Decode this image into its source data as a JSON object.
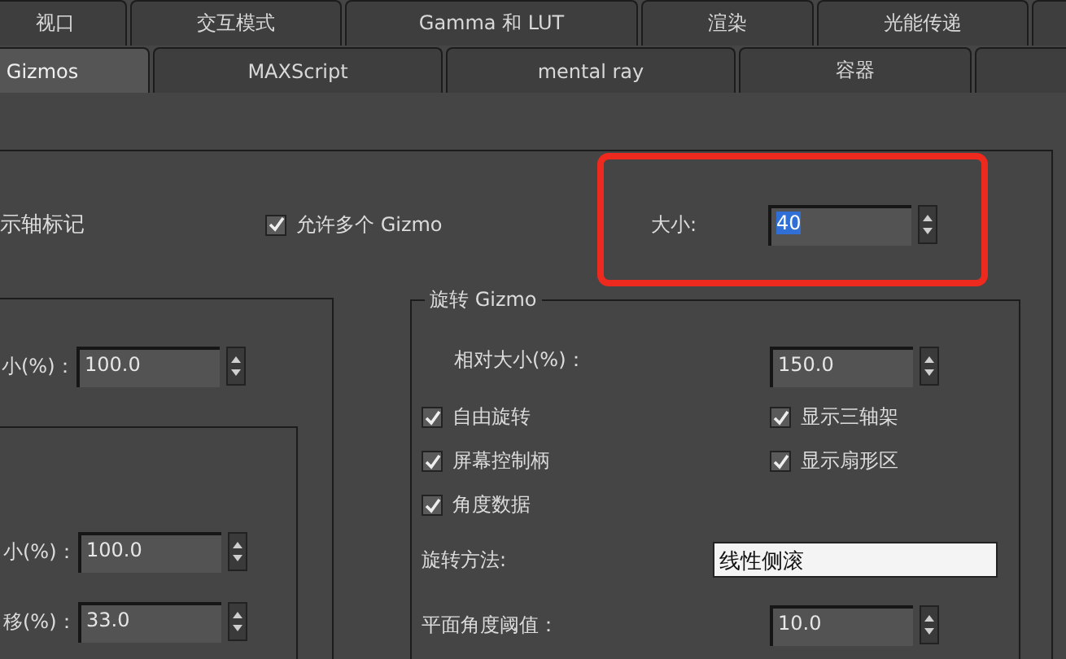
{
  "tabs_row_1": [
    {
      "label": "视口",
      "selected": false
    },
    {
      "label": "交互模式",
      "selected": false
    },
    {
      "label": "Gamma 和 LUT",
      "selected": false
    },
    {
      "label": "渲染",
      "selected": false
    },
    {
      "label": "光能传递",
      "selected": false
    }
  ],
  "tabs_row_2": [
    {
      "label": "Gizmos",
      "selected": true
    },
    {
      "label": "MAXScript",
      "selected": false
    },
    {
      "label": "mental ray",
      "selected": false
    },
    {
      "label": "容器",
      "selected": false
    }
  ],
  "axis_label": "示轴标记",
  "allow_multiple": {
    "label": "允许多个 Gizmo",
    "checked": true
  },
  "size": {
    "label": "大小:",
    "value": "40",
    "value_selected": true
  },
  "left_group": {
    "fields": [
      {
        "label": "小(%)：",
        "value": "100.0"
      }
    ]
  },
  "inner_group": {
    "fields": [
      {
        "label": "小(%)：",
        "value": "100.0"
      },
      {
        "label": "移(%)：",
        "value": "33.0"
      }
    ]
  },
  "rotation_gizmo": {
    "title": "旋转 Gizmo",
    "relative_size": {
      "label": "相对大小(%)：",
      "value": "150.0"
    },
    "options": [
      {
        "label": "自由旋转",
        "checked": true
      },
      {
        "label": "显示三轴架",
        "checked": true
      },
      {
        "label": "屏幕控制柄",
        "checked": true
      },
      {
        "label": "显示扇形区",
        "checked": true
      },
      {
        "label": "角度数据",
        "checked": true
      }
    ],
    "method": {
      "label": "旋转方法:",
      "value": "线性侧滚"
    },
    "threshold": {
      "label": "平面角度阈值：",
      "value": "10.0"
    }
  }
}
